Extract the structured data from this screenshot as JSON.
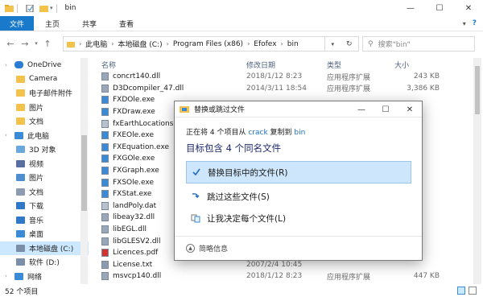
{
  "window": {
    "title": "bin",
    "controls": {
      "minimize": "—",
      "maximize": "☐",
      "close": "✕"
    }
  },
  "ribbon": {
    "tabs": [
      "文件",
      "主页",
      "共享",
      "查看"
    ],
    "help": "?"
  },
  "address": {
    "crumbs": [
      "此电脑",
      "本地磁盘 (C:)",
      "Program Files (x86)",
      "Efofex",
      "bin"
    ],
    "search_placeholder": "搜索\"bin\""
  },
  "nav": {
    "items": [
      {
        "label": "OneDrive",
        "level": 0,
        "icon": "cloud-icon",
        "color": "#2b7cd3"
      },
      {
        "label": "Camera",
        "level": 1,
        "icon": "folder-icon",
        "color": "#f3c24c"
      },
      {
        "label": "电子邮件附件",
        "level": 1,
        "icon": "folder-icon",
        "color": "#f3c24c"
      },
      {
        "label": "图片",
        "level": 1,
        "icon": "folder-icon",
        "color": "#f3c24c"
      },
      {
        "label": "文档",
        "level": 1,
        "icon": "folder-icon",
        "color": "#f3c24c"
      },
      {
        "label": "此电脑",
        "level": 0,
        "icon": "computer-icon",
        "color": "#3a8ad6"
      },
      {
        "label": "3D 对象",
        "level": 1,
        "icon": "cube-icon",
        "color": "#6aa7dc"
      },
      {
        "label": "视频",
        "level": 1,
        "icon": "video-icon",
        "color": "#5a6fa1"
      },
      {
        "label": "图片",
        "level": 1,
        "icon": "pictures-icon",
        "color": "#4f8fd1"
      },
      {
        "label": "文档",
        "level": 1,
        "icon": "documents-icon",
        "color": "#8c9bb0"
      },
      {
        "label": "下载",
        "level": 1,
        "icon": "download-icon",
        "color": "#2f79c8"
      },
      {
        "label": "音乐",
        "level": 1,
        "icon": "music-icon",
        "color": "#2f79c8"
      },
      {
        "label": "桌面",
        "level": 1,
        "icon": "desktop-icon",
        "color": "#3a8ad6"
      },
      {
        "label": "本地磁盘 (C:)",
        "level": 1,
        "icon": "drive-icon",
        "color": "#7a8ea8",
        "selected": true
      },
      {
        "label": "软件 (D:)",
        "level": 1,
        "icon": "drive-icon",
        "color": "#7a8ea8"
      },
      {
        "label": "网络",
        "level": 0,
        "icon": "network-icon",
        "color": "#3a8ad6"
      }
    ]
  },
  "columns": {
    "name": "名称",
    "date": "修改日期",
    "type": "类型",
    "size": "大小"
  },
  "files": [
    {
      "name": "concrt140.dll",
      "date": "2018/1/12 8:23",
      "type": "应用程序扩展",
      "size": "243 KB",
      "icon": "dll-icon"
    },
    {
      "name": "D3Dcompiler_47.dll",
      "date": "2014/3/11 18:54",
      "type": "应用程序扩展",
      "size": "3,386 KB",
      "icon": "dll-icon"
    },
    {
      "name": "FXDOle.exe",
      "date": "",
      "type": "",
      "size": "",
      "icon": "exe-icon"
    },
    {
      "name": "FXDraw.exe",
      "date": "",
      "type": "",
      "size": "",
      "icon": "exe-icon"
    },
    {
      "name": "fxEarthLocations.dat",
      "date": "",
      "type": "",
      "size": "",
      "icon": "dat-icon"
    },
    {
      "name": "FXEOle.exe",
      "date": "",
      "type": "",
      "size": "",
      "icon": "exe-icon"
    },
    {
      "name": "FXEquation.exe",
      "date": "",
      "type": "",
      "size": "",
      "icon": "exe-icon"
    },
    {
      "name": "FXGOle.exe",
      "date": "",
      "type": "",
      "size": "",
      "icon": "exe-icon"
    },
    {
      "name": "FXGraph.exe",
      "date": "",
      "type": "",
      "size": "",
      "icon": "exe-icon"
    },
    {
      "name": "FXSOle.exe",
      "date": "",
      "type": "",
      "size": "",
      "icon": "exe-icon"
    },
    {
      "name": "FXStat.exe",
      "date": "",
      "type": "",
      "size": "",
      "icon": "exe-icon"
    },
    {
      "name": "landPoly.dat",
      "date": "",
      "type": "",
      "size": "",
      "icon": "dat-icon"
    },
    {
      "name": "libeay32.dll",
      "date": "",
      "type": "",
      "size": "",
      "icon": "dll-icon"
    },
    {
      "name": "libEGL.dll",
      "date": "",
      "type": "",
      "size": "",
      "icon": "dll-icon"
    },
    {
      "name": "libGLESV2.dll",
      "date": "",
      "type": "",
      "size": "",
      "icon": "dll-icon"
    },
    {
      "name": "Licences.pdf",
      "date": "",
      "type": "",
      "size": "",
      "icon": "pdf-icon"
    },
    {
      "name": "License.txt",
      "date": "2007/2/4 10:45",
      "type": "",
      "size": "",
      "icon": "txt-icon"
    },
    {
      "name": "msvcp140.dll",
      "date": "2018/1/12 8:23",
      "type": "应用程序扩展",
      "size": "447 KB",
      "icon": "dll-icon"
    }
  ],
  "status": {
    "count": "52 个项目"
  },
  "dialog": {
    "title": "替换或跳过文件",
    "line1_prefix": "正在将 4 个项目从",
    "line1_src": "crack",
    "line1_mid": "复制到",
    "line1_dst": "bin",
    "line2": "目标包含 4 个同名文件",
    "options": [
      {
        "label": "替换目标中的文件(R)",
        "icon": "checkmark-icon",
        "selected": true
      },
      {
        "label": "跳过这些文件(S)",
        "icon": "skip-icon",
        "selected": false
      },
      {
        "label": "让我决定每个文件(L)",
        "icon": "decide-icon",
        "selected": false
      }
    ],
    "footer": "简略信息"
  }
}
